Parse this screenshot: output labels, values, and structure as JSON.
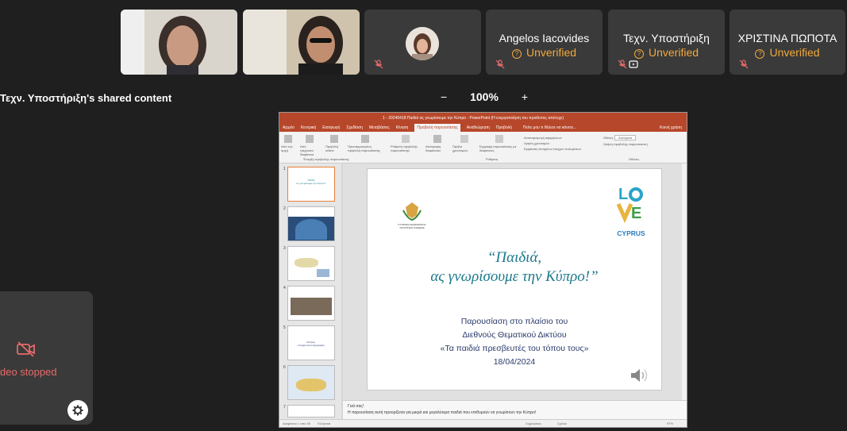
{
  "participants": [
    {
      "type": "video"
    },
    {
      "type": "video"
    },
    {
      "type": "avatar",
      "muted": true
    },
    {
      "name": "Angelos Iacovides",
      "status": "Unverified",
      "muted": true
    },
    {
      "name": "Τεχν. Υποστήριξη",
      "status": "Unverified",
      "muted": true,
      "sharing": true
    },
    {
      "name": "ΧΡΙΣΤΙΝΑ ΠΩΠΟΤΑ",
      "status": "Unverified",
      "muted": true
    }
  ],
  "shared": {
    "title": "Τεχν. Υποστήριξη's shared content",
    "zoom_minus": "−",
    "zoom_level": "100%",
    "zoom_plus": "+"
  },
  "ppt": {
    "window_title": "1 - 20240418 Παιδιά ας γνωρίσουμε την Κύπρο - PowerPoint (Η ενεργοποίηση του προϊόντος απέτυχε)",
    "tabs": [
      "Αρχείο",
      "Κεντρική",
      "Εισαγωγή",
      "Σχεδίαση",
      "Μεταβάσεις",
      "Κίνηση",
      "Προβολή παρουσίασης",
      "Αναθεώρηση",
      "Προβολή"
    ],
    "tell_me": "Πείτε μου τι θέλετε να κάνετε...",
    "share": "Κοινή χρήση",
    "ribbon_groups": [
      "Έναρξη προβολής παρουσίασης",
      "Ρύθμιση",
      "Οθόνες"
    ],
    "ribbon_buttons": [
      "Από την αρχή",
      "Από τρέχουσα διαφάνεια",
      "Προβολή online",
      "Προσαρμοσμένη προβολή παρουσίασης",
      "Ρύθμιση προβολής παρουσίασης",
      "Απόκρυψη διαφάνειας",
      "Πρόβα χρονισμών",
      "Εγγραφή παρουσίασης με διαφάνειες"
    ],
    "ribbon_checks": [
      "Αναπαραγωγή αφηγήσεων",
      "Χρήση χρονισμών",
      "Εμφάνιση στοιχείων ελέγχου πολυμέσων",
      "Χρήση προβολής παρουσιαστή"
    ],
    "monitor_label": "Οθόνη:",
    "monitor_value": "Αυτόματα",
    "thumb_numbers": [
      "1",
      "2",
      "3",
      "4",
      "5",
      "6",
      "7"
    ],
    "slide": {
      "org_text": "ΚΥΠΡΙΑΚΗ ΔΗΜΟΚΡΑΤΙΑ ΥΠΟΥΡΓΕΙΟ ΠΑΙΔΕΙΑΣ",
      "title_line1": "“Παιδιά,",
      "title_line2": "ας γνωρίσουμε την Κύπρο!”",
      "sub1": "Παρουσίαση στο πλαίσιο του",
      "sub2": "Διεθνούς Θεματικού Δικτύου",
      "sub3": "«Τα παιδιά πρεσβευτές του τόπου τους»",
      "date": "18/04/2024",
      "logo_text": "CYPRUS"
    },
    "notes_line1": "Γειά σας!",
    "notes_line2": "Η παρουσίαση αυτή προορίζεται για μικρά και μεγαλύτερα παιδιά που επιθυμούν να γνωρίσουν την Κύπρο!",
    "status_left": "Διαφάνεια 1 από 50",
    "status_lang": "Ελληνικά",
    "status_notes": "Σημειώσεις",
    "status_comments": "Σχόλια",
    "status_zoom": "97%"
  },
  "self_view": {
    "label": "deo stopped"
  },
  "colors": {
    "background": "#1f1f1f",
    "unverified": "#f0a93b",
    "ppt_accent": "#b7472a",
    "slide_title": "#1d7a8c",
    "slide_sub": "#2a3a6b",
    "video_off": "#e86a6a"
  }
}
